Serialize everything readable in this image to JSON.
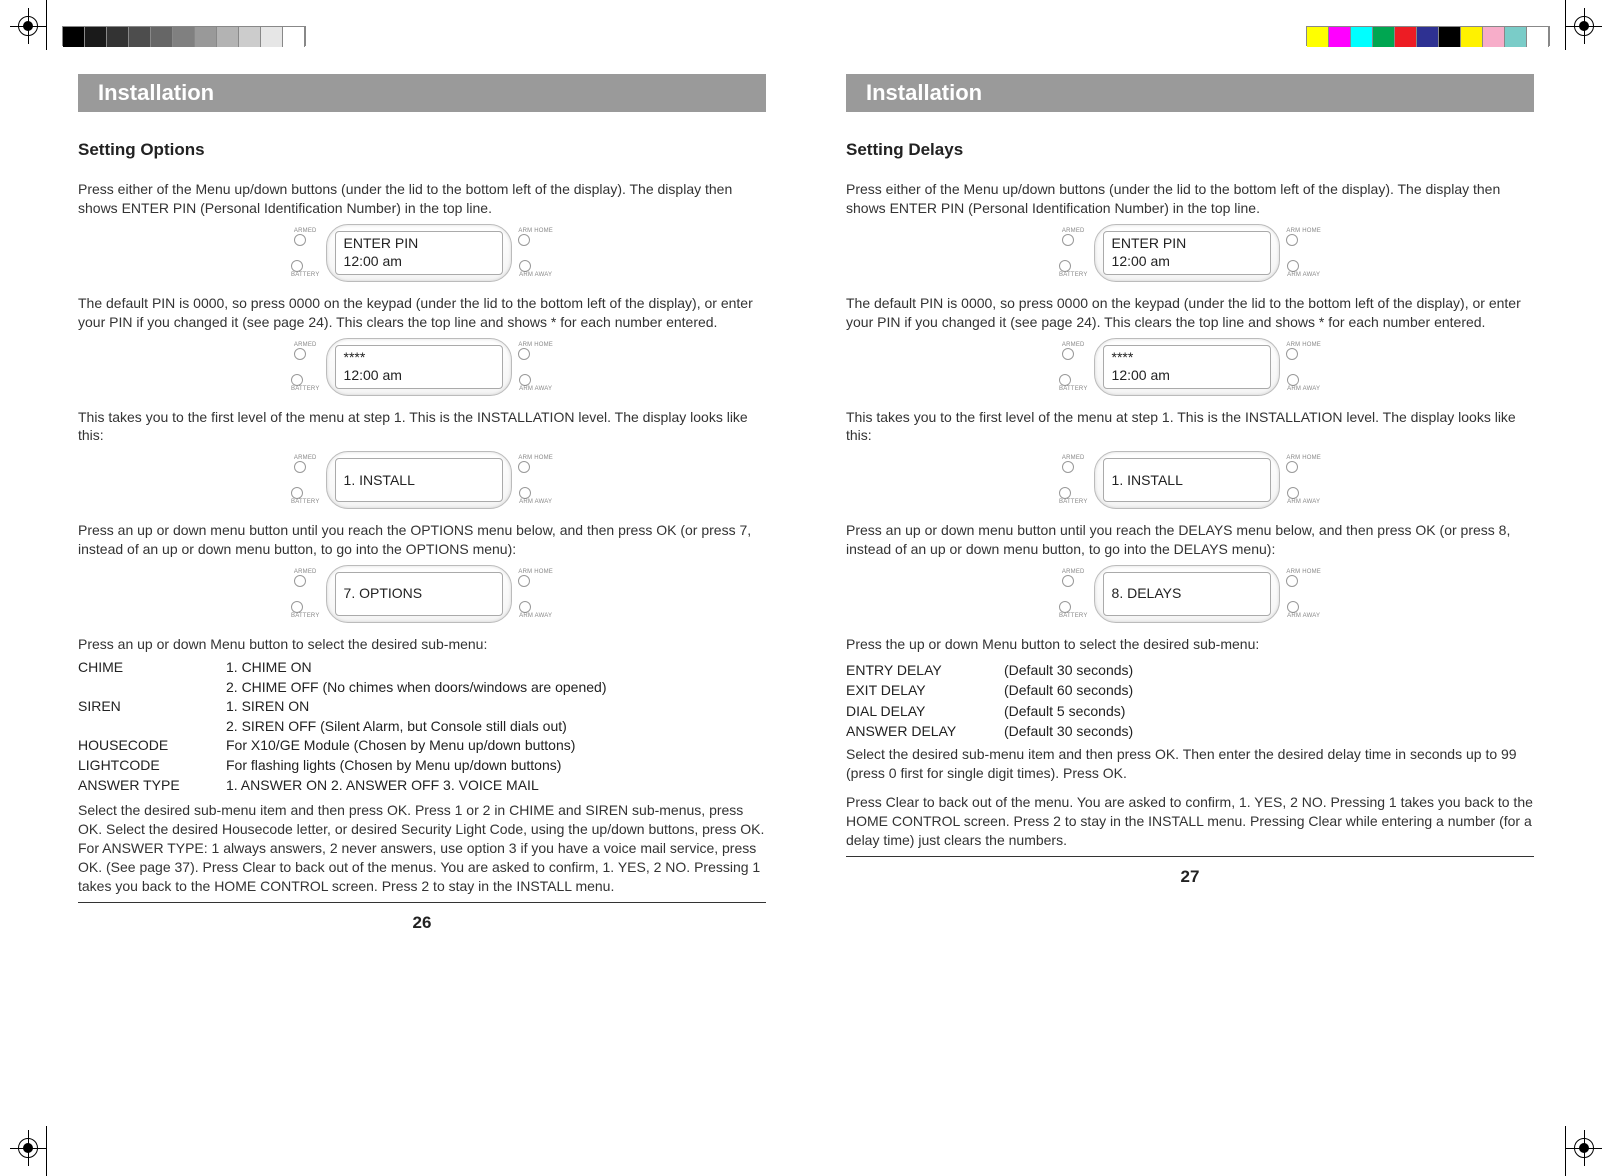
{
  "left": {
    "banner": "Installation",
    "subhead": "Setting Options",
    "p1": "Press either of the Menu up/down buttons (under the lid to the bottom left of the display). The display then shows ENTER PIN (Personal Identification Number) in the top line.",
    "lcd1_l1": "ENTER PIN",
    "lcd1_l2": "12:00 am",
    "p2": "The default PIN is 0000, so press 0000 on the keypad (under the lid to the bottom left of the display), or enter your PIN if you changed it (see page 24). This clears the top line and shows * for each number entered.",
    "lcd2_l1": "****",
    "lcd2_l2": "12:00 am",
    "p3": "This takes you to the first level of the menu at step 1. This is the INSTALLATION level. The display looks like this:",
    "lcd3_l1": "1. INSTALL",
    "p4": "Press an up or down menu button until you reach the OPTIONS menu below, and then press OK (or press 7, instead of an up or down menu button, to go into the OPTIONS menu):",
    "lcd4_l1": "7. OPTIONS",
    "p5": "Press an up or down Menu button to select the desired sub-menu:",
    "menu": {
      "chime_k": "CHIME",
      "chime_v1": "1. CHIME ON",
      "chime_v2": "2. CHIME OFF (No chimes when doors/windows are opened)",
      "siren_k": "SIREN",
      "siren_v1": "1. SIREN ON",
      "siren_v2": "2. SIREN OFF (Silent Alarm, but Console still dials out)",
      "house_k": "HOUSECODE",
      "house_v": "For X10/GE Module (Chosen by Menu up/down buttons)",
      "light_k": "LIGHTCODE",
      "light_v": "For flashing lights (Chosen by Menu up/down buttons)",
      "answer_k": "ANSWER TYPE",
      "answer_v": "1. ANSWER ON  2. ANSWER OFF  3. VOICE MAIL"
    },
    "p6": "Select the desired sub-menu item and then press OK. Press 1 or 2 in CHIME and SIREN sub-menus, press OK. Select the desired Housecode letter, or desired Security Light Code, using the up/down buttons, press OK. For ANSWER TYPE: 1 always answers, 2 never answers, use option 3 if you have a voice mail service, press OK. (See page 37). Press Clear to back out of the menus. You are asked to confirm, 1. YES, 2 NO. Pressing 1 takes you back to the HOME CONTROL screen. Press 2 to stay in the INSTALL menu.",
    "pagenum": "26"
  },
  "right": {
    "banner": "Installation",
    "subhead": "Setting Delays",
    "p1": "Press either of the Menu up/down buttons (under the lid to the bottom left of the display). The display then shows ENTER PIN (Personal Identification Number) in the top line.",
    "lcd1_l1": "ENTER PIN",
    "lcd1_l2": "12:00 am",
    "p2": "The default PIN is 0000, so press 0000 on the keypad (under the lid to the bottom left of the display), or enter your PIN if you changed it (see page 24). This clears the top line and shows * for each number entered.",
    "lcd2_l1": "****",
    "lcd2_l2": "12:00 am",
    "p3": "This takes you to the first level of the menu at step 1. This is the INSTALLATION level. The display looks like this:",
    "lcd3_l1": "1. INSTALL",
    "p4": "Press an up or down menu button until you reach the DELAYS menu below, and then press OK (or press 8, instead of an up or down menu button, to go into the DELAYS menu):",
    "lcd4_l1": "8. DELAYS",
    "p5": "Press the up or down Menu button to select the desired sub-menu:",
    "delays": {
      "entry_k": "ENTRY DELAY",
      "entry_v": "(Default 30 seconds)",
      "exit_k": "EXIT DELAY",
      "exit_v": "(Default 60 seconds)",
      "dial_k": "DIAL DELAY",
      "dial_v": "(Default 5 seconds)",
      "answer_k": "ANSWER DELAY",
      "answer_v": "(Default 30 seconds)"
    },
    "p6": "Select the desired sub-menu item and then press OK. Then enter the desired delay time in seconds up to 99 (press 0 first for single digit times). Press OK.",
    "p7": "Press Clear to back out of the menu. You are asked to confirm, 1. YES, 2 NO. Pressing 1 takes you back to the HOME CONTROL screen. Press 2 to stay in the INSTALL menu. Pressing Clear while entering a number (for a delay time) just clears the numbers.",
    "pagenum": "27"
  },
  "labels": {
    "armed": "ARMED",
    "battery": "BATTERY",
    "arm_home": "ARM HOME",
    "arm_away": "ARM AWAY"
  }
}
